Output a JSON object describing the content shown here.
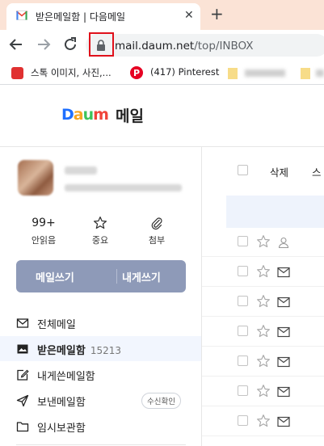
{
  "browser": {
    "tab_title": "받은메일함 | 다음메일",
    "tab_close": "✕",
    "new_tab": "+",
    "url_host": "mail.daum.net",
    "url_path": "/top/INBOX",
    "bookmarks": [
      {
        "label": "스톡 이미지, 사진,...",
        "icon": "red-square-icon"
      },
      {
        "label": "(417) Pinterest",
        "icon": "pinterest-icon"
      }
    ]
  },
  "header": {
    "logo_text": "Daum",
    "service_name": "메일"
  },
  "shortcuts": [
    {
      "top": "99+",
      "label": "안읽음",
      "icon": "unread-count"
    },
    {
      "top": "",
      "label": "중요",
      "icon": "star-icon"
    },
    {
      "top": "",
      "label": "첨부",
      "icon": "paperclip-icon"
    }
  ],
  "compose": {
    "write_mail": "메일쓰기",
    "write_to_me": "내게쓰기"
  },
  "folders": [
    {
      "label": "전체메일",
      "count": "",
      "icon": "mail-icon",
      "active": false
    },
    {
      "label": "받은메일함",
      "count": "15213",
      "icon": "inbox-icon",
      "active": true
    },
    {
      "label": "내게쓴메일함",
      "count": "",
      "icon": "edit-note-icon",
      "active": false
    },
    {
      "label": "보낸메일함",
      "count": "",
      "icon": "send-icon",
      "active": false,
      "badge": "수신확인"
    },
    {
      "label": "임시보관함",
      "count": "",
      "icon": "folder-icon",
      "active": false
    }
  ],
  "toolbar": {
    "delete_label": "삭제",
    "more_label": "스"
  },
  "mail_rows": [
    {
      "icon": "person-icon"
    },
    {
      "icon": "envelope-icon"
    },
    {
      "icon": "envelope-icon"
    },
    {
      "icon": "envelope-icon"
    },
    {
      "icon": "envelope-icon"
    },
    {
      "icon": "envelope-icon"
    },
    {
      "icon": "envelope-icon"
    }
  ],
  "colors": {
    "tab_strip": "#fbe3d6",
    "compose_button": "#8e9ab8",
    "active_folder": "#f2f6fe",
    "highlight_box": "#e0111b"
  }
}
